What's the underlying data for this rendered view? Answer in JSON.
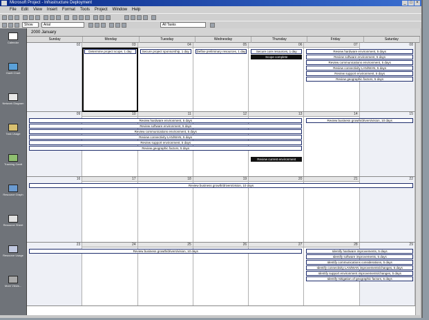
{
  "window": {
    "title": "Microsoft Project - Infrastructure Deployment"
  },
  "menu": [
    "File",
    "Edit",
    "View",
    "Insert",
    "Format",
    "Tools",
    "Project",
    "Window",
    "Help"
  ],
  "toolbar": {
    "filter_value": "All Tasks",
    "font_value": "Arial",
    "show_label": "Show"
  },
  "viewbar": [
    "Calendar",
    "Gantt Chart",
    "Network Diagram",
    "Task Usage",
    "Tracking Gantt",
    "Resource Graph",
    "Resource Sheet",
    "Resource Usage",
    "More Views..."
  ],
  "calendar": {
    "month": "2000 January",
    "days": [
      "Sunday",
      "Monday",
      "Tuesday",
      "Wednesday",
      "Thursday",
      "Friday",
      "Saturday"
    ],
    "weeks": [
      {
        "dates": [
          "02",
          "03",
          "04",
          "05",
          "06",
          "07",
          "08"
        ],
        "bars": [
          {
            "label": "Determine project scope, 1 day",
            "start": 1,
            "end": 1,
            "row": 0,
            "selected": true
          },
          {
            "label": "Secure project sponsorship, 1 day",
            "start": 2,
            "end": 2,
            "row": 0
          },
          {
            "label": "Define preliminary resources, 1 day",
            "start": 3,
            "end": 3,
            "row": 0
          },
          {
            "label": "Secure core resources, 1 day",
            "start": 4,
            "end": 4,
            "row": 0
          },
          {
            "label": "Scope complete",
            "start": 4,
            "end": 4,
            "row": 1,
            "milestone": true
          },
          {
            "label": "Review hardware environment, 5 days",
            "start": 5,
            "end": 6,
            "row": 0
          },
          {
            "label": "Review software environment, 5 days",
            "start": 5,
            "end": 6,
            "row": 1
          },
          {
            "label": "Review communications environment, 5 days",
            "start": 5,
            "end": 6,
            "row": 2
          },
          {
            "label": "Review connectivity LAN/WAN, 5 days",
            "start": 5,
            "end": 6,
            "row": 3
          },
          {
            "label": "Review support environment, 5 days",
            "start": 5,
            "end": 6,
            "row": 4
          },
          {
            "label": "Review geographic factors, 5 days",
            "start": 5,
            "end": 6,
            "row": 5
          }
        ]
      },
      {
        "dates": [
          "09",
          "10",
          "11",
          "12",
          "13",
          "14",
          "15"
        ],
        "bars": [
          {
            "label": "Review hardware environment, 5 days",
            "start": 0,
            "end": 4,
            "row": 0
          },
          {
            "label": "Review software environment, 5 days",
            "start": 0,
            "end": 4,
            "row": 1
          },
          {
            "label": "Review communications environment, 5 days",
            "start": 0,
            "end": 4,
            "row": 2
          },
          {
            "label": "Review connectivity LAN/WAN, 5 days",
            "start": 0,
            "end": 4,
            "row": 3
          },
          {
            "label": "Review support environment, 5 days",
            "start": 0,
            "end": 4,
            "row": 4
          },
          {
            "label": "Review geographic factors, 5 days",
            "start": 0,
            "end": 4,
            "row": 5
          },
          {
            "label": "Review current environment",
            "start": 4,
            "end": 4,
            "row": 7,
            "milestone": true
          },
          {
            "label": "Review business growth/drivers/vision, 10 days",
            "start": 5,
            "end": 6,
            "row": 0
          }
        ]
      },
      {
        "dates": [
          "16",
          "17",
          "18",
          "19",
          "20",
          "21",
          "22"
        ],
        "bars": [
          {
            "label": "Review business growth/drivers/vision, 10 days",
            "start": 0,
            "end": 6,
            "row": 0
          }
        ]
      },
      {
        "dates": [
          "23",
          "24",
          "25",
          "26",
          "27",
          "28",
          "29"
        ],
        "bars": [
          {
            "label": "Review business growth/drivers/vision, 10 days",
            "start": 0,
            "end": 4,
            "row": 0
          },
          {
            "label": "Identify hardware improvements, 5 days",
            "start": 5,
            "end": 6,
            "row": 0
          },
          {
            "label": "Identify software improvements, 5 days",
            "start": 5,
            "end": 6,
            "row": 1
          },
          {
            "label": "Identify communications considerations, 5 days",
            "start": 5,
            "end": 6,
            "row": 2
          },
          {
            "label": "Identify connectivity LAN/WAN improvements/changes, 5 days",
            "start": 5,
            "end": 6,
            "row": 3
          },
          {
            "label": "Identify support environment improvements/changes, 5 days",
            "start": 5,
            "end": 6,
            "row": 4
          },
          {
            "label": "Identify mitigation of geographic factors, 5 days",
            "start": 5,
            "end": 6,
            "row": 5
          }
        ]
      }
    ]
  },
  "colors": {
    "titlebar": "#0a2a88",
    "bar_border": "#1b2a6a",
    "milestone": "#111111",
    "weekend": "#eef0f6"
  }
}
